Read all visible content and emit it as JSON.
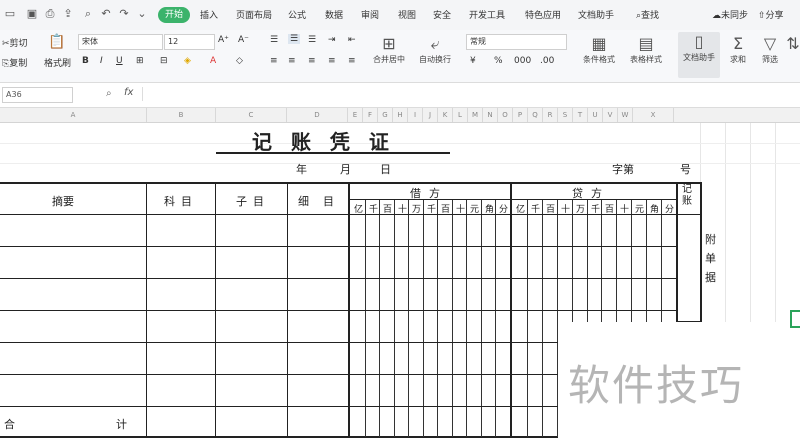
{
  "menubar": {
    "tabs": [
      "开始",
      "插入",
      "页面布局",
      "公式",
      "数据",
      "审阅",
      "视图",
      "安全",
      "开发工具",
      "特色应用",
      "文档助手"
    ],
    "active_tab": "开始",
    "search": "查找",
    "collab": "未同步",
    "share": "分享"
  },
  "ribbon": {
    "cut": "剪切",
    "copy": "复制",
    "format_painter": "格式刷",
    "font_name": "宋体",
    "font_size": "12",
    "bold": "B",
    "italic": "I",
    "underline": "U",
    "merge": "合并居中",
    "wrap": "自动换行",
    "number_format": "常规",
    "cond_format": "条件格式",
    "table_style": "表格样式",
    "doc_assistant": "文档助手",
    "sum": "求和",
    "filter": "筛选",
    "sort": "排序"
  },
  "formula_bar": {
    "cell_ref": "A36",
    "fx": "fx",
    "value": ""
  },
  "columns": [
    "A",
    "B",
    "C",
    "D",
    "E",
    "F",
    "G",
    "H",
    "I",
    "J",
    "K",
    "L",
    "M",
    "N",
    "O",
    "P",
    "Q",
    "R",
    "S",
    "T",
    "U",
    "V",
    "W",
    "X"
  ],
  "voucher": {
    "title": "记 账 凭 证",
    "year": "年",
    "month": "月",
    "day": "日",
    "zi": "字第",
    "hao": "号",
    "summary": "摘要",
    "account": "科目",
    "sub_account": "子目",
    "detail": "细目",
    "debit": "借方",
    "credit": "贷方",
    "posted": "记账",
    "units": [
      "亿",
      "千",
      "百",
      "十",
      "万",
      "千",
      "百",
      "十",
      "元",
      "角",
      "分"
    ],
    "attach": "附单据",
    "total_left": "合",
    "total_right": "计"
  },
  "watermark": "软件技巧"
}
